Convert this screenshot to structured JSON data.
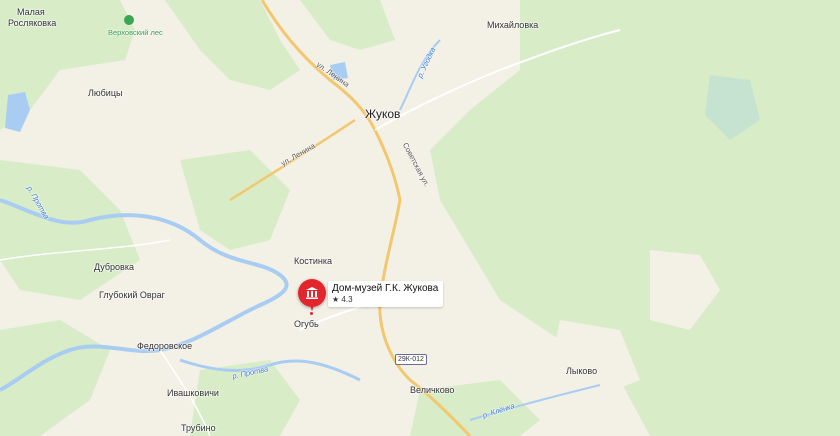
{
  "map": {
    "colors": {
      "land": "#f3f0e6",
      "forest": "#d7ecc7",
      "water": "#a9cdf2",
      "road_major": "#f3c76e",
      "road_minor": "#ffffff",
      "marker": "#e3262e"
    },
    "labels": {
      "malaya_roslyakovka_1": "Малая",
      "malaya_roslyakovka_2": "Росляковка",
      "verkhovsky_les": "Верховский лес",
      "mikhaylovka": "Михайловка",
      "lyubitsy": "Любицы",
      "ul_lenina_top": "ул. Ленина",
      "r_ugodka": "р. Угодка",
      "zhukov": "Жуков",
      "ul_lenina_mid": "ул. Ленина",
      "sovetskaya": "Советская ул.",
      "r_protva_left": "р. Протва",
      "kostinka": "Костинка",
      "dubrovka": "Дубровка",
      "glubokiy_ovrag": "Глубокий Овраг",
      "ogub": "Огубь",
      "fedorovskoe": "Федоровское",
      "r_protva_bottom": "р. Протва",
      "ivashkovichi": "Ивашковичи",
      "velichkovo": "Величково",
      "lykovo": "Лыково",
      "r_klyonka": "р. Клёнка",
      "trubino": "Трубино"
    },
    "road_badge": "29К-012",
    "poi": {
      "name": "Дом-музей Г.К. Жукова",
      "rating": "★ 4.3",
      "icon": "museum-icon"
    }
  }
}
